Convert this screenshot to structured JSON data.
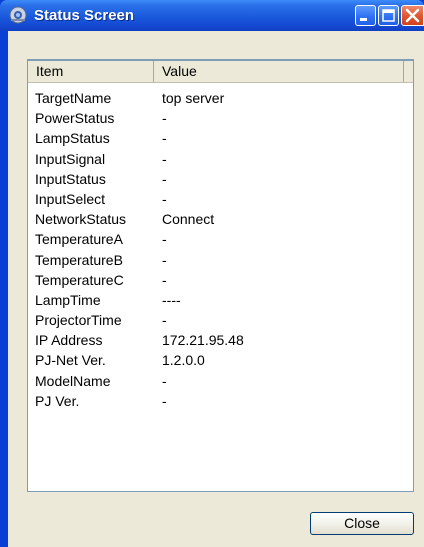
{
  "window": {
    "title": "Status Screen",
    "title_icon": "projector-icon"
  },
  "list": {
    "headers": [
      "Item",
      "Value"
    ],
    "rows": [
      {
        "item": "TargetName",
        "value": "top server"
      },
      {
        "item": "PowerStatus",
        "value": "-"
      },
      {
        "item": "LampStatus",
        "value": "-"
      },
      {
        "item": "InputSignal",
        "value": "-"
      },
      {
        "item": "InputStatus",
        "value": "-"
      },
      {
        "item": "InputSelect",
        "value": "-"
      },
      {
        "item": "NetworkStatus",
        "value": "Connect"
      },
      {
        "item": "TemperatureA",
        "value": "-"
      },
      {
        "item": "TemperatureB",
        "value": "-"
      },
      {
        "item": "TemperatureC",
        "value": "-"
      },
      {
        "item": "LampTime",
        "value": "----"
      },
      {
        "item": "ProjectorTime",
        "value": "-"
      },
      {
        "item": "IP Address",
        "value": "172.21.95.48"
      },
      {
        "item": "PJ-Net Ver.",
        "value": "1.2.0.0"
      },
      {
        "item": "ModelName",
        "value": "-"
      },
      {
        "item": "PJ Ver.",
        "value": "-"
      }
    ]
  },
  "buttons": {
    "close_label": "Close"
  },
  "colors": {
    "titlebar": "#1a59dc",
    "dialog_bg": "#ece9d8",
    "close_btn": "#d2431c"
  }
}
